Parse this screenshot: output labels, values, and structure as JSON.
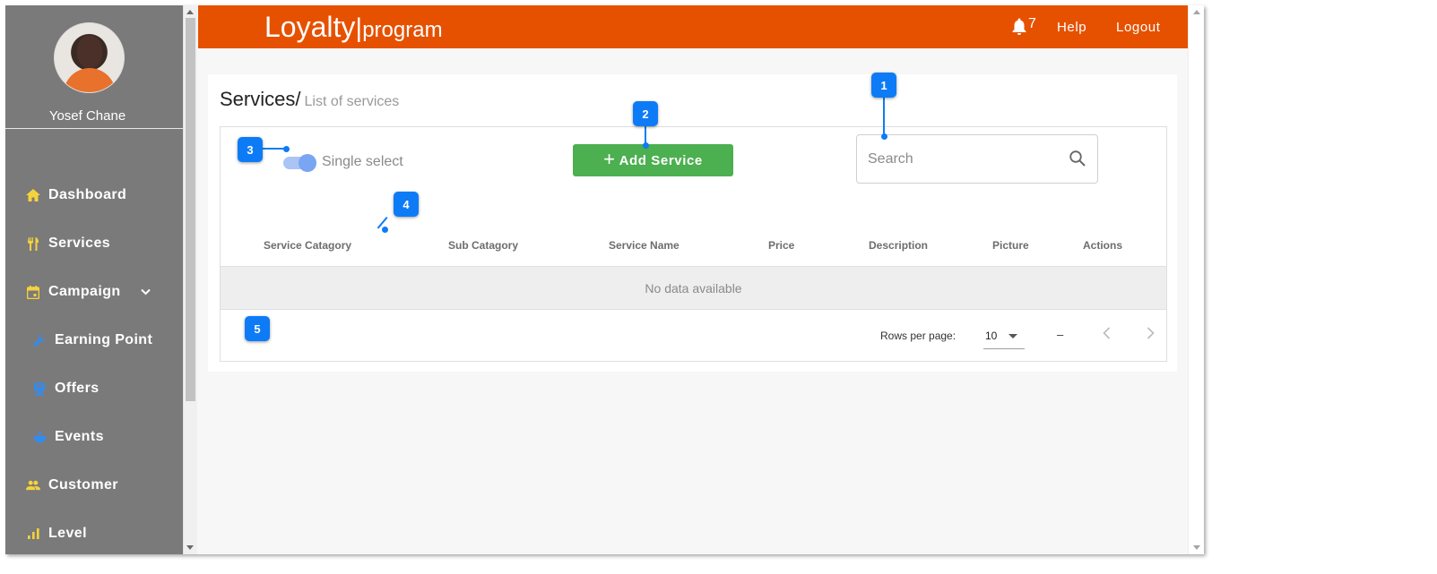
{
  "sidebar": {
    "user_name": "Yosef Chane",
    "items": [
      {
        "label": "Dashboard",
        "icon": "home-icon"
      },
      {
        "label": "Services",
        "icon": "fork-knife-icon"
      },
      {
        "label": "Campaign",
        "icon": "calendar-icon",
        "has_dropdown": true
      },
      {
        "label": "Earning Point",
        "icon": "wrench-icon"
      },
      {
        "label": "Offers",
        "icon": "offers-icon"
      },
      {
        "label": "Events",
        "icon": "events-icon"
      },
      {
        "label": "Customer",
        "icon": "people-icon"
      },
      {
        "label": "Level",
        "icon": "bar-chart-icon"
      }
    ],
    "icon_color_primary": "#f5d33b",
    "icon_color_sub": "#2f8cf5"
  },
  "header": {
    "brand_main": "Loyalty",
    "brand_sep": "|",
    "brand_sub": "program",
    "notification_count": "7",
    "help_label": "Help",
    "logout_label": "Logout",
    "bg_color": "#e65100"
  },
  "page": {
    "title": "Services/",
    "subtitle": "List of services"
  },
  "toolbar": {
    "toggle_label": "Single select",
    "toggle_on": true,
    "add_button_label": "Add Service",
    "search_placeholder": "Search"
  },
  "table": {
    "columns": [
      "Service Catagory",
      "Sub Catagory",
      "Service Name",
      "Price",
      "Description",
      "Picture",
      "Actions"
    ],
    "empty_text": "No data available"
  },
  "pagination": {
    "rows_per_page_label": "Rows per page:",
    "rows_per_page_value": "10",
    "range_text": "–"
  },
  "callouts": [
    "1",
    "2",
    "3",
    "4",
    "5"
  ],
  "colors": {
    "accent_green": "#4caf50",
    "callout_blue": "#0e7bf6"
  }
}
